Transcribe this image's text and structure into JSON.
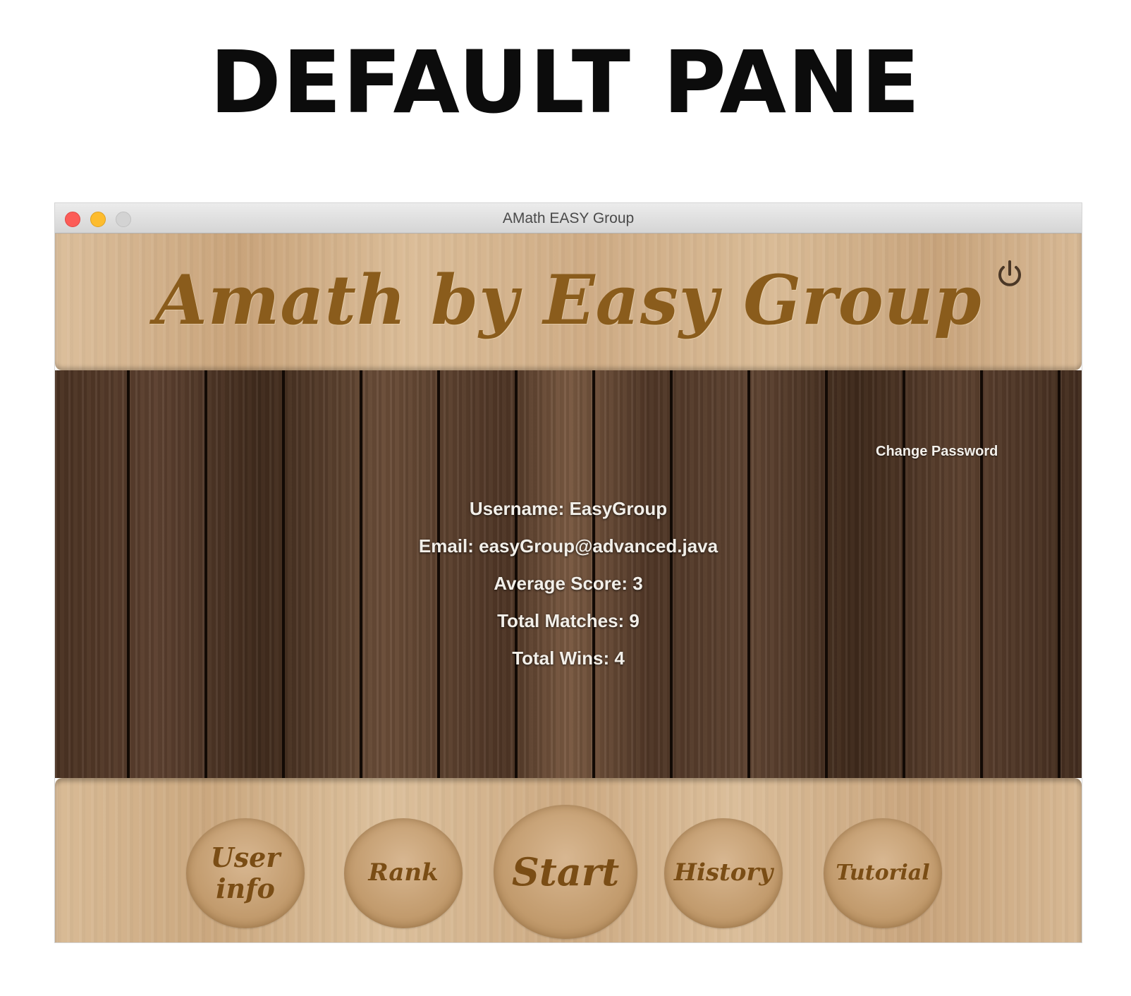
{
  "page": {
    "heading": "DEFAULT PANE"
  },
  "window": {
    "title": "AMath EASY Group"
  },
  "header": {
    "app_title": "Amath by Easy Group"
  },
  "content": {
    "change_password_label": "Change Password",
    "user": {
      "username": "Username: EasyGroup",
      "email": "Email: easyGroup@advanced.java",
      "average_score": "Average Score: 3",
      "total_matches": "Total Matches: 9",
      "total_wins": "Total Wins: 4"
    }
  },
  "nav": {
    "user_info": "User\ninfo",
    "rank": "Rank",
    "start": "Start",
    "history": "History",
    "tutorial": "Tutorial"
  },
  "icons": {
    "power": "power-icon"
  },
  "colors": {
    "title_text": "#8a5c1c",
    "button_text": "#7a4d15",
    "light_text": "#f2efe9"
  }
}
